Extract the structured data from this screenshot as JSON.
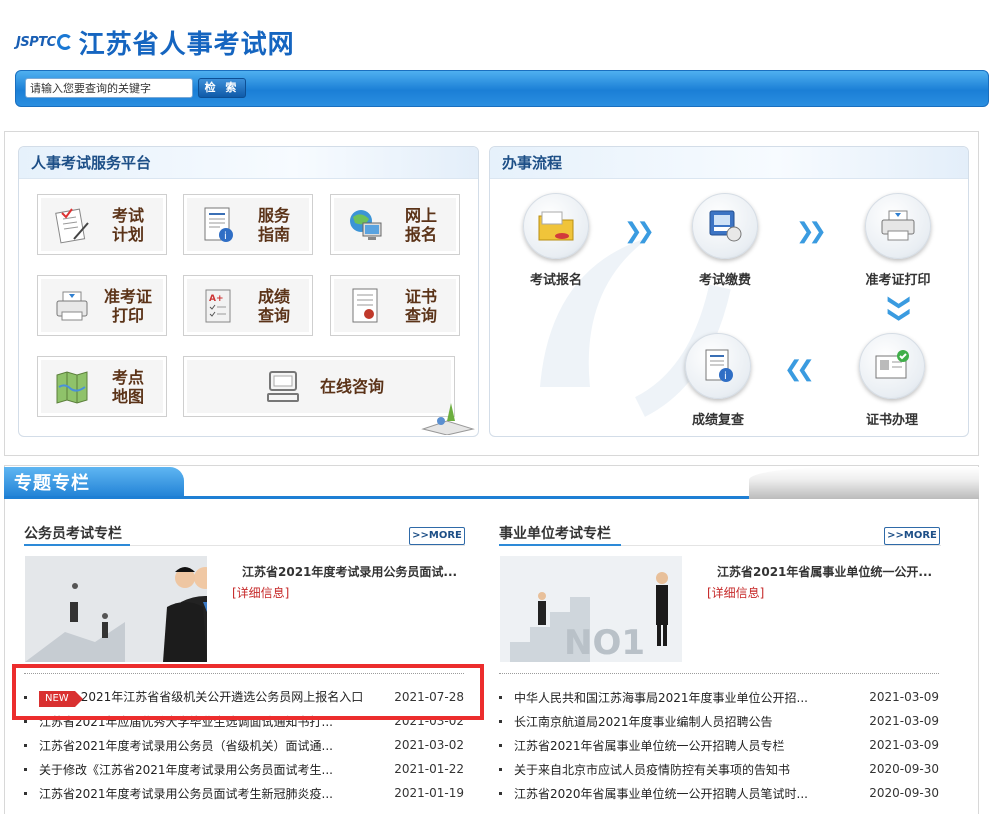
{
  "header": {
    "logo_mark": "JSPTC",
    "site_title": "江苏省人事考试网"
  },
  "search": {
    "placeholder": "请输入您要查询的关键字",
    "button_label": "检 索"
  },
  "service_platform": {
    "title": "人事考试服务平台",
    "tiles": [
      {
        "line1": "考试",
        "line2": "计划",
        "icon": "exam-plan-icon"
      },
      {
        "line1": "服务",
        "line2": "指南",
        "icon": "service-guide-icon"
      },
      {
        "line1": "网上",
        "line2": "报名",
        "icon": "online-signup-icon"
      },
      {
        "line1": "准考证",
        "line2": "打印",
        "icon": "admission-print-icon"
      },
      {
        "line1": "成绩",
        "line2": "查询",
        "icon": "score-query-icon"
      },
      {
        "line1": "证书",
        "line2": "查询",
        "icon": "certificate-query-icon"
      },
      {
        "line1": "考点",
        "line2": "地图",
        "icon": "map-icon"
      },
      {
        "line1": "在线咨询",
        "line2": "",
        "icon": "computer-icon"
      }
    ]
  },
  "process": {
    "title": "办事流程",
    "steps": [
      {
        "label": "考试报名",
        "icon": "folder-icon"
      },
      {
        "label": "考试缴费",
        "icon": "payment-icon"
      },
      {
        "label": "准考证打印",
        "icon": "printer-icon"
      },
      {
        "label": "成绩复查",
        "icon": "report-icon"
      },
      {
        "label": "证书办理",
        "icon": "certificate-icon"
      }
    ]
  },
  "topics": {
    "title": "专题专栏",
    "more_label": "MORE",
    "civil": {
      "title": "公务员考试专栏",
      "feature_title": "江苏省2021年度考试录用公务员面试...",
      "feature_link": "[详细信息]",
      "items": [
        {
          "badge": "NEW",
          "text": "2021年江苏省省级机关公开遴选公务员网上报名入口",
          "date": "2021-07-28"
        },
        {
          "text": "江苏省2021年应届优秀大学毕业生选调面试通知书打...",
          "date": "2021-03-02"
        },
        {
          "text": "江苏省2021年度考试录用公务员（省级机关）面试通...",
          "date": "2021-03-02"
        },
        {
          "text": "关于修改《江苏省2021年度考试录用公务员面试考生...",
          "date": "2021-01-22"
        },
        {
          "text": "江苏省2021年度考试录用公务员面试考生新冠肺炎疫...",
          "date": "2021-01-19"
        }
      ]
    },
    "institution": {
      "title": "事业单位考试专栏",
      "feature_title": "江苏省2021年省属事业单位统一公开...",
      "feature_link": "[详细信息]",
      "items": [
        {
          "text": "中华人民共和国江苏海事局2021年度事业单位公开招...",
          "date": "2021-03-09"
        },
        {
          "text": "长江南京航道局2021年度事业编制人员招聘公告",
          "date": "2021-03-09"
        },
        {
          "text": "江苏省2021年省属事业单位统一公开招聘人员专栏",
          "date": "2021-03-09"
        },
        {
          "text": "关于来自北京市应试人员疫情防控有关事项的告知书",
          "date": "2020-09-30"
        },
        {
          "text": "江苏省2020年省属事业单位统一公开招聘人员笔试时...",
          "date": "2020-09-30"
        }
      ]
    }
  }
}
